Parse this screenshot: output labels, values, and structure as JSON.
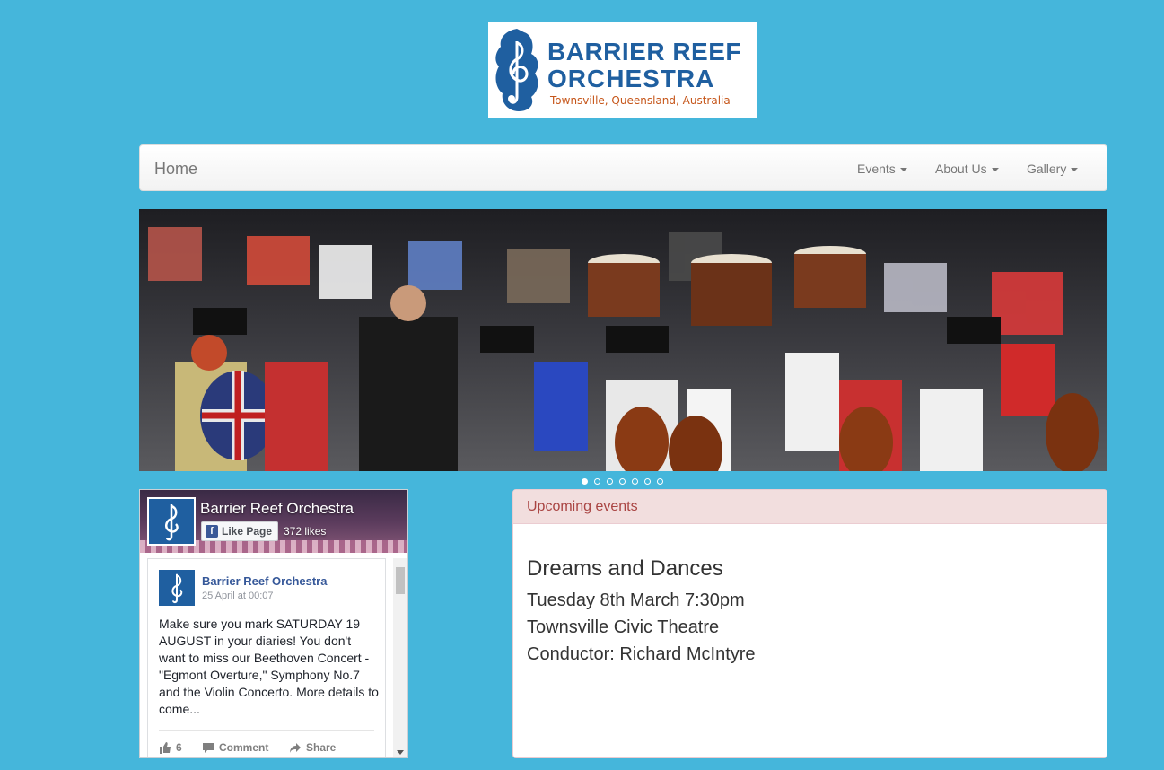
{
  "logo": {
    "line1": "BARRIER REEF",
    "line2": "ORCHESTRA",
    "line3": "Townsville, Queensland, Australia",
    "icon": "treble-clef-seahorse-icon",
    "color_primary": "#1f5fa0",
    "color_accent": "#c6561a"
  },
  "navbar": {
    "brand": "Home",
    "items": [
      {
        "label": "Events"
      },
      {
        "label": "About Us"
      },
      {
        "label": "Gallery"
      }
    ]
  },
  "carousel": {
    "slide_count": 7,
    "active_index": 0
  },
  "facebook": {
    "page_name": "Barrier Reef Orchestra",
    "like_button": "Like Page",
    "likes": "372 likes",
    "post": {
      "author": "Barrier Reef Orchestra",
      "time": "25 April at 00:07",
      "text": "Make sure you mark SATURDAY 19 AUGUST in your diaries! You don't want to miss our Beethoven Concert - \"Egmont Overture,\" Symphony No.7 and the Violin Concerto. More details to come...",
      "like_count": "6",
      "comment_label": "Comment",
      "share_label": "Share"
    },
    "brand_color": "#3b5998"
  },
  "events": {
    "heading": "Upcoming events",
    "title": "Dreams and Dances",
    "date": "Tuesday 8th March 7:30pm",
    "venue": "Townsville Civic Theatre",
    "conductor": "Conductor: Richard McIntyre",
    "header_bg": "#f2dede",
    "header_text": "#a94442"
  },
  "page": {
    "background": "#45b6db"
  }
}
